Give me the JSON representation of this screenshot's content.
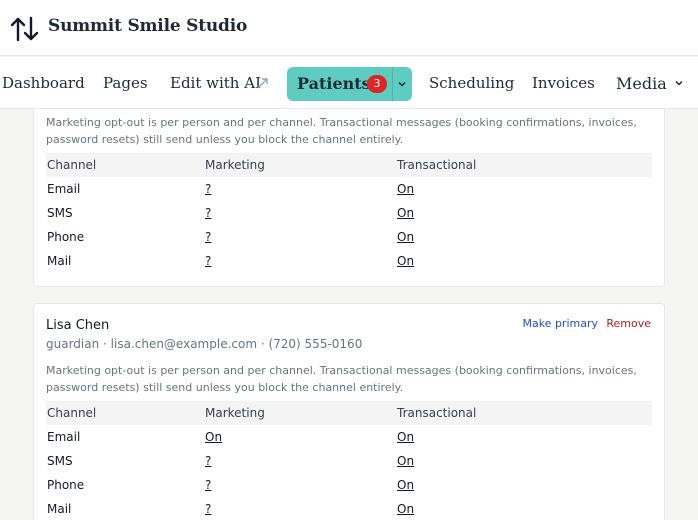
{
  "brand": {
    "name": "Summit Smile Studio"
  },
  "nav": {
    "items": [
      {
        "label": "Dashboard"
      },
      {
        "label": "Pages"
      },
      {
        "label": "Edit with AI"
      },
      {
        "label": "Patients",
        "badge": "3",
        "active": true
      },
      {
        "label": "Scheduling"
      },
      {
        "label": "Invoices"
      },
      {
        "label": "Media"
      }
    ]
  },
  "note": "Marketing opt-out is per person and per channel. Transactional messages (booking confirmations, invoices, password resets) still send unless you block the channel entirely.",
  "columns": [
    "Channel",
    "Marketing",
    "Transactional"
  ],
  "contacts": [
    {
      "rows": [
        {
          "channel": "Email",
          "marketing": "?",
          "transactional": "On"
        },
        {
          "channel": "SMS",
          "marketing": "?",
          "transactional": "On"
        },
        {
          "channel": "Phone",
          "marketing": "?",
          "transactional": "On"
        },
        {
          "channel": "Mail",
          "marketing": "?",
          "transactional": "On"
        }
      ]
    },
    {
      "name": "Lisa Chen",
      "meta": "guardian · lisa.chen@example.com · (720) 555-0160",
      "actions": {
        "primary": "Make primary",
        "remove": "Remove"
      },
      "rows": [
        {
          "channel": "Email",
          "marketing": "On",
          "transactional": "On"
        },
        {
          "channel": "SMS",
          "marketing": "?",
          "transactional": "On"
        },
        {
          "channel": "Phone",
          "marketing": "?",
          "transactional": "On"
        },
        {
          "channel": "Mail",
          "marketing": "?",
          "transactional": "On"
        }
      ]
    }
  ],
  "colors": {
    "accent": "#5eccc0",
    "badge": "#dc2626",
    "link": "#1d4ed8",
    "danger": "#b91c1c"
  }
}
